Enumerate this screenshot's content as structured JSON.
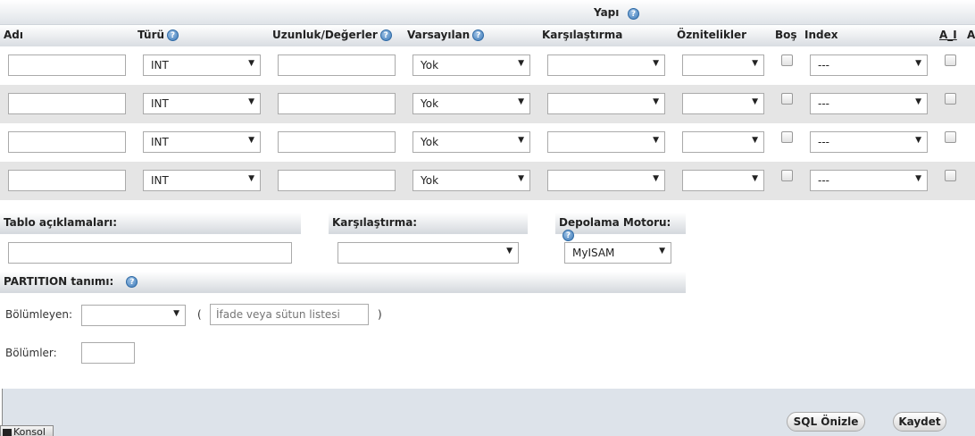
{
  "structure": {
    "title": "Yapı"
  },
  "columns": {
    "name": "Adı",
    "type": "Türü",
    "length": "Uzunluk/Değerler",
    "default": "Varsayılan",
    "collation": "Karşılaştırma",
    "attributes": "Öznitelikler",
    "null": "Boş",
    "index": "Index",
    "ai": "A_I",
    "comments_partial": "A"
  },
  "rows": [
    {
      "name": "",
      "type": "INT",
      "length": "",
      "default": "Yok",
      "collation": "",
      "attributes": "",
      "null": false,
      "index": "---",
      "ai": false
    },
    {
      "name": "",
      "type": "INT",
      "length": "",
      "default": "Yok",
      "collation": "",
      "attributes": "",
      "null": false,
      "index": "---",
      "ai": false
    },
    {
      "name": "",
      "type": "INT",
      "length": "",
      "default": "Yok",
      "collation": "",
      "attributes": "",
      "null": false,
      "index": "---",
      "ai": false
    },
    {
      "name": "",
      "type": "INT",
      "length": "",
      "default": "Yok",
      "collation": "",
      "attributes": "",
      "null": false,
      "index": "---",
      "ai": false
    }
  ],
  "table_options": {
    "comments_label": "Tablo açıklamaları:",
    "comments_value": "",
    "collation_label": "Karşılaştırma:",
    "collation_value": "",
    "engine_label": "Depolama Motoru:",
    "engine_value": "MyISAM"
  },
  "partition": {
    "title": "PARTITION tanımı:",
    "partition_by_label": "Bölümleyen:",
    "partition_by_value": "",
    "open_paren": "(",
    "close_paren": ")",
    "expression_placeholder": "İfade veya sütun listesi",
    "partitions_label": "Bölümler:",
    "partitions_value": ""
  },
  "buttons": {
    "preview_sql": "SQL Önizle",
    "save": "Kaydet"
  },
  "console": {
    "label": "Konsol"
  },
  "icons": {
    "help": "help-icon",
    "dropdown": "chevron-down-icon"
  }
}
